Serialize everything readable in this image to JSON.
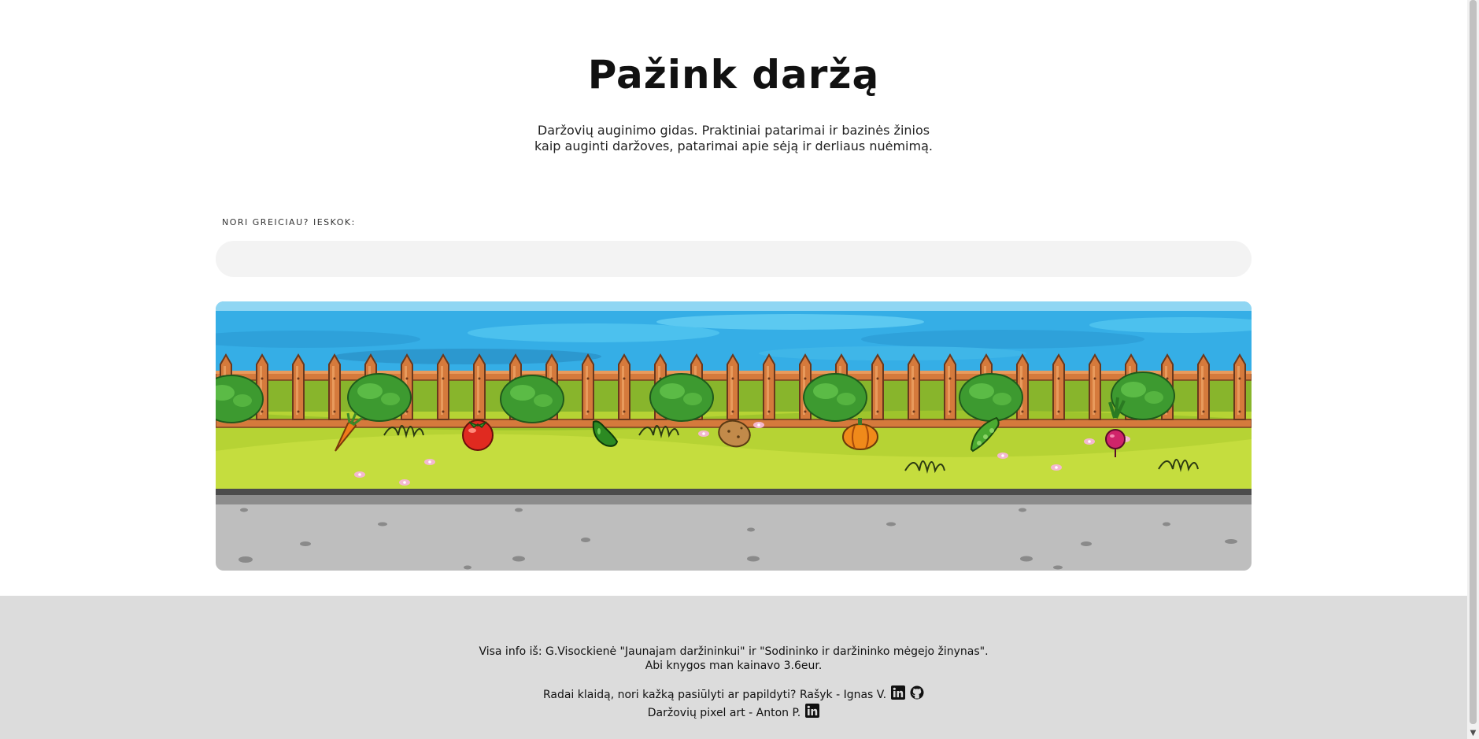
{
  "header": {
    "title": "Pažink daržą",
    "subtitle_line1": "Daržovių auginimo gidas. Praktiniai patarimai ir bazinės žinios",
    "subtitle_line2": "kaip auginti daržoves, patarimai apie sėją ir derliaus nuėmimą."
  },
  "search": {
    "label": "NORI GREICIAU? IESKOK:",
    "value": "",
    "placeholder": ""
  },
  "garden": {
    "vegetables": [
      "carrot",
      "tomato",
      "cucumber",
      "potato",
      "pumpkin",
      "pea",
      "radish"
    ],
    "colors": {
      "sky": "#35aee6",
      "fence": "#d57a3c",
      "grass": "#b6d334",
      "sidewalk": "#bebebe"
    }
  },
  "footer": {
    "line1": "Visa info iš: G.Visockienė \"Jaunajam daržininkui\" ir \"Sodininko ir daržininko mėgejo žinynas\".",
    "line2": "Abi knygos man kainavo 3.6eur.",
    "line3": "Radai klaidą, nori kažką pasiūlyti ar papildyti? Rašyk - Ignas V.",
    "line4": "Daržovių pixel art - Anton P.",
    "icons": [
      "linkedin-icon",
      "github-icon",
      "linkedin-icon"
    ]
  }
}
